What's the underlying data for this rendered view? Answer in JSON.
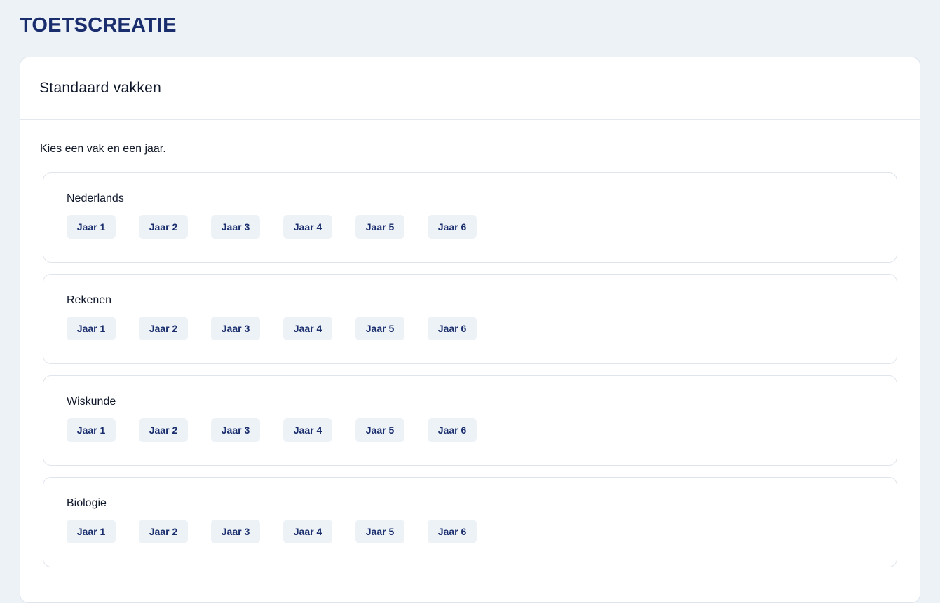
{
  "page": {
    "title": "TOETSCREATIE"
  },
  "card": {
    "title": "Standaard vakken",
    "instruction": "Kies een vak en een jaar."
  },
  "subjects": [
    {
      "name": "Nederlands",
      "years": [
        "Jaar 1",
        "Jaar 2",
        "Jaar 3",
        "Jaar 4",
        "Jaar 5",
        "Jaar 6"
      ]
    },
    {
      "name": "Rekenen",
      "years": [
        "Jaar 1",
        "Jaar 2",
        "Jaar 3",
        "Jaar 4",
        "Jaar 5",
        "Jaar 6"
      ]
    },
    {
      "name": "Wiskunde",
      "years": [
        "Jaar 1",
        "Jaar 2",
        "Jaar 3",
        "Jaar 4",
        "Jaar 5",
        "Jaar 6"
      ]
    },
    {
      "name": "Biologie",
      "years": [
        "Jaar 1",
        "Jaar 2",
        "Jaar 3",
        "Jaar 4",
        "Jaar 5",
        "Jaar 6"
      ]
    }
  ],
  "colors": {
    "brand": "#1a2e6e",
    "background": "#edf2f7",
    "button_bg": "#edf2f7"
  }
}
